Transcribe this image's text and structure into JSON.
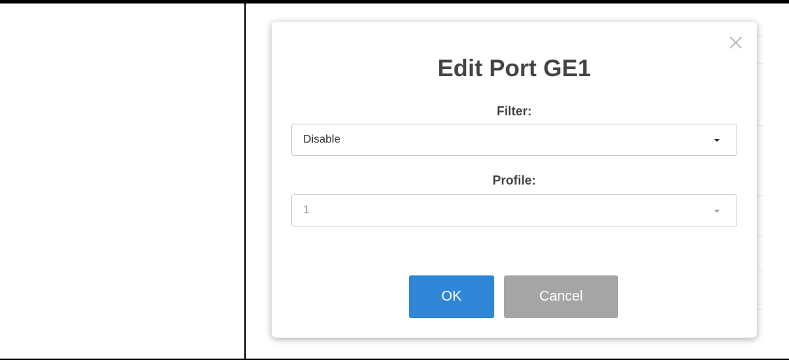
{
  "modal": {
    "title": "Edit Port GE1",
    "close_icon": "close-icon",
    "filter": {
      "label": "Filter:",
      "value": "Disable"
    },
    "profile": {
      "label": "Profile:",
      "value": "1"
    },
    "ok_label": "OK",
    "cancel_label": "Cancel"
  },
  "colors": {
    "ok_button": "#2f86d6",
    "cancel_button": "#a5a5a5",
    "title_text": "#444444"
  }
}
